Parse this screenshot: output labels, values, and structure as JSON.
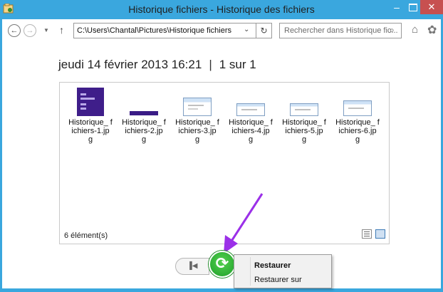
{
  "window": {
    "title": "Historique fichiers - Historique des fichiers",
    "minimize_glyph": "–",
    "close_glyph": "✕"
  },
  "nav": {
    "back_icon": "back-arrow-icon",
    "forward_icon": "forward-arrow-icon",
    "address": "C:\\Users\\Chantal\\Pictures\\Historique fichiers",
    "search_placeholder": "Rechercher dans Historique fic...",
    "glyphs": {
      "back": "←",
      "forward": "→",
      "history_dropdown": "▼",
      "up": "↑",
      "address_dropdown": "⌄",
      "refresh": "↻",
      "search": "⌕",
      "home": "⌂",
      "settings": "✿"
    }
  },
  "header": {
    "date": "jeudi 14 février 2013 16:21",
    "separator": "|",
    "page": "1 sur 1"
  },
  "files": [
    {
      "name": "Historique_ fichiers-1.jp g"
    },
    {
      "name": "Historique_ fichiers-2.jp g"
    },
    {
      "name": "Historique_ fichiers-3.jp g"
    },
    {
      "name": "Historique_ fichiers-4.jp g"
    },
    {
      "name": "Historique_ fichiers-5.jp g"
    },
    {
      "name": "Historique_ fichiers-6.jp g"
    }
  ],
  "status": {
    "count": "6 élément(s)"
  },
  "controls": {
    "previous_glyph": "▐◀",
    "restore_glyph": "⟳"
  },
  "context_menu": {
    "items": [
      "Restaurer",
      "Restaurer sur"
    ]
  },
  "colors": {
    "titlebar": "#3aa7de",
    "close": "#c75050",
    "restore_green": "#2fb53a",
    "annotation_arrow": "#9b30e8"
  }
}
